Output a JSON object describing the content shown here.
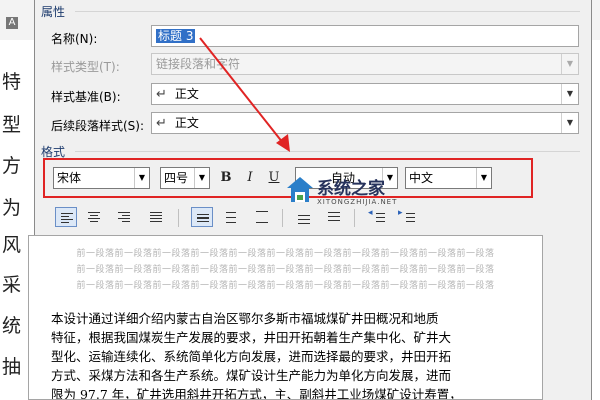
{
  "background": {
    "letters": [
      "特",
      "型",
      "方",
      "为",
      "风",
      "采",
      "统",
      "抽"
    ],
    "a_icon": "A"
  },
  "dialog": {
    "properties_title": "属性",
    "name_label": "名称(N):",
    "name_value": "标题 3",
    "style_type_label": "样式类型(T):",
    "style_type_value": "链接段落和字符",
    "based_on_label": "样式基准(B):",
    "based_on_value": "正文",
    "following_label": "后续段落样式(S):",
    "following_value": "正文",
    "format_title": "格式"
  },
  "format_toolbar": {
    "font": "宋体",
    "size": "四号",
    "bold": "B",
    "italic": "I",
    "underline": "U",
    "color": "自动",
    "language": "中文"
  },
  "preview": {
    "prev_paragraph": "前一段落前一段落前一段落前一段落前一段落前一段落前一段落前一段落前一段落前一段落前一段落",
    "body_lines": [
      "本设计通过详细介绍内蒙古自治区鄂尔多斯市福城煤矿井田概况和地质",
      "特征，根据我国煤炭生产发展的要求，井田开拓朝着生产集中化、矿井大",
      "型化、运输连续化、系统简单化方向发展，进而选择最的要求，井田开拓",
      "方式、采煤方法和各生产系统。煤矿设计生产能力为单化方向发展，进而",
      "限为 97.7 年，矿井选用斜井开拓方式，主、副斜井工业场煤矿设计寿置，"
    ]
  },
  "watermark": {
    "title": "系统之家",
    "subtitle": "XITONGZHIJIA.NET"
  },
  "colors": {
    "highlight_box": "#e02424",
    "arrow": "#e02424",
    "selection": "#3170c7"
  }
}
